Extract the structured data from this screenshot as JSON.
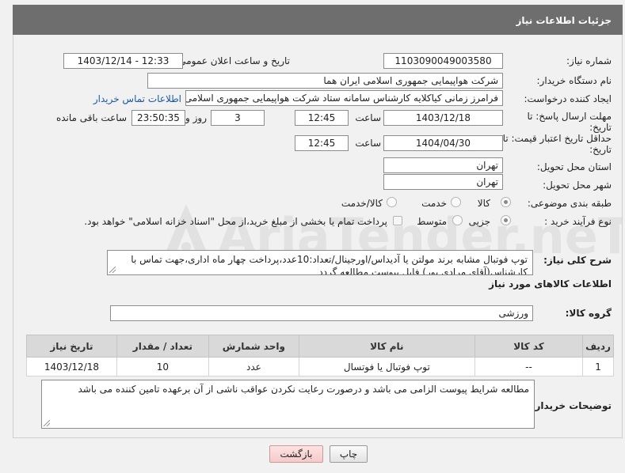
{
  "header": {
    "title": "جزئیات اطلاعات نیاز"
  },
  "fields": {
    "need_number": {
      "label": "شماره نیاز:",
      "value": "1103090049003580"
    },
    "announce_datetime": {
      "label": "تاریخ و ساعت اعلان عمومی:",
      "value": "1403/12/14 - 12:33"
    },
    "buyer_org": {
      "label": "نام دستگاه خریدار:",
      "value": "شرکت هواپیمایی جمهوری اسلامی ایران هما"
    },
    "requester": {
      "label": "ایجاد کننده درخواست:",
      "value": "فرامرز زمانی کیاکلایه کارشناس سامانه ستاد شرکت هواپیمایی جمهوری اسلامی",
      "link": "اطلاعات تماس خریدار"
    },
    "reply_deadline": {
      "label_line1": "مهلت ارسال پاسخ: تا",
      "label_line2": "تاریخ:",
      "date": "1403/12/18",
      "time_label": "ساعت",
      "time": "12:45",
      "days": "3",
      "days_label": "روز و",
      "remaining": "23:50:35",
      "remaining_label": "ساعت باقی مانده"
    },
    "price_validity": {
      "label_line1": "حداقل تاریخ اعتبار قیمت: تا",
      "label_line2": "تاریخ:",
      "date": "1404/04/30",
      "time_label": "ساعت",
      "time": "12:45"
    },
    "province": {
      "label": "استان محل تحویل:",
      "value": "تهران"
    },
    "city": {
      "label": "شهر محل تحویل:",
      "value": "تهران"
    },
    "category": {
      "label": "طبقه بندی موضوعی:",
      "options": [
        "کالا",
        "خدمت",
        "کالا/خدمت"
      ],
      "selected": "کالا"
    },
    "process_type": {
      "label": "نوع فرآیند خرید :",
      "options": [
        "جزیی",
        "متوسط"
      ],
      "selected": "جزیی",
      "checkbox_text": "پرداخت تمام یا بخشی از مبلغ خرید،از محل \"اسناد خزانه اسلامی\" خواهد بود."
    },
    "description": {
      "label": "شرح کلی نیاز:",
      "value": "توپ فوتبال مشابه برند مولتن یا آدیداس/اورجینال/تعداد:10عدد،پرداخت چهار ماه اداری،جهت تماس با کارشناس(آقای مرادی پور) فایل پیوست مطالعه گردد"
    }
  },
  "goods_section": {
    "title": "اطلاعات کالاهای مورد نیاز",
    "group_label": "گروه کالا:",
    "group_value": "ورزشی",
    "columns": [
      "ردیف",
      "کد کالا",
      "نام کالا",
      "واحد شمارش",
      "تعداد / مقدار",
      "تاریخ نیاز"
    ],
    "rows": [
      [
        "1",
        "--",
        "توپ فوتبال یا فوتسال",
        "عدد",
        "10",
        "1403/12/18"
      ]
    ]
  },
  "buyer_notes": {
    "label": "توضیحات خریدار:",
    "value": "مطالعه شرایط پیوست الزامی می باشد و درصورت رعایت نکردن عواقب ناشی از آن برعهده تامین کننده می باشد"
  },
  "buttons": {
    "print": "چاپ",
    "back": "بازگشت"
  },
  "watermark": {
    "text": "AriaTender.neT"
  },
  "colors": {
    "header_bg": "#6e6e6e",
    "link": "#1a5aa0",
    "back_button": "#f5caca"
  }
}
